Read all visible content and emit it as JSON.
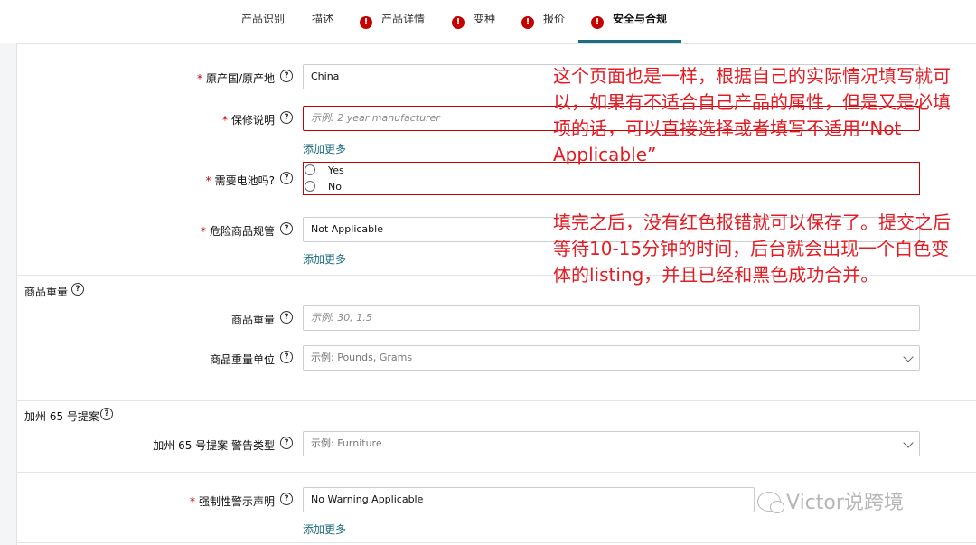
{
  "tabs": [
    {
      "label": "产品识别",
      "error": false
    },
    {
      "label": "描述",
      "error": false
    },
    {
      "label": "产品详情",
      "error": true
    },
    {
      "label": "变种",
      "error": true
    },
    {
      "label": "报价",
      "error": true
    },
    {
      "label": "安全与合规",
      "error": true,
      "active": true
    }
  ],
  "error_glyph": "!",
  "help_glyph": "?",
  "required_mark": "*",
  "fields": {
    "origin": {
      "label": "原产国/原产地",
      "value": "China"
    },
    "warranty": {
      "label": "保修说明",
      "placeholder": "示例:  2 year manufacturer",
      "add_more": "添加更多"
    },
    "battery": {
      "label": "需要电池吗?",
      "options": [
        "Yes",
        "No"
      ]
    },
    "hazmat": {
      "label": "危险商品规管",
      "value": "Not Applicable",
      "add_more": "添加更多"
    },
    "weight_section": {
      "title": "商品重量"
    },
    "weight": {
      "label": "商品重量",
      "placeholder": "示例:  30, 1.5"
    },
    "weight_unit": {
      "label": "商品重量单位",
      "placeholder": "示例:   Pounds, Grams"
    },
    "prop65_section": {
      "title": "加州 65 号提案"
    },
    "prop65_type": {
      "label": "加州 65 号提案 警告类型",
      "placeholder": "示例:   Furniture"
    },
    "warning": {
      "label": "强制性警示声明",
      "value": "No Warning Applicable",
      "add_more": "添加更多"
    }
  },
  "annotations": {
    "note1": "这个页面也是一样，根据自己的实际情况填写就可以，如果有不适合自己产品的属性，但是又是必填项的话，可以直接选择或者填写不适用“Not Applicable”",
    "note2": "填完之后，没有红色报错就可以保存了。提交之后等待10-15分钟的时间，后台就会出现一个白色变体的listing，并且已经和黑色成功合并。"
  },
  "watermark": "Victor说跨境"
}
